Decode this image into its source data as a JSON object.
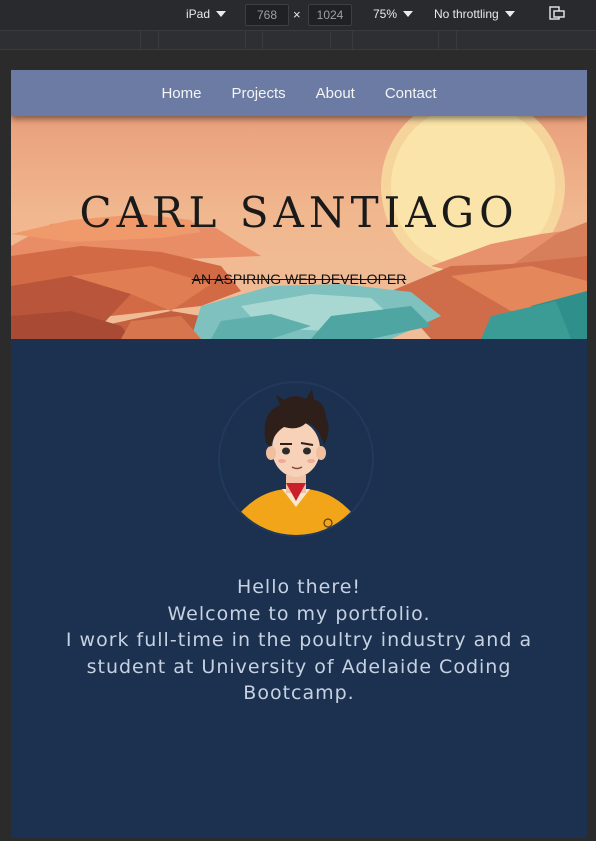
{
  "devtools": {
    "device": "iPad",
    "width": "768",
    "height": "1024",
    "times": "×",
    "zoom": "75%",
    "throttling": "No throttling",
    "rotate_icon": "rotate-icon"
  },
  "nav": {
    "items": [
      {
        "label": "Home"
      },
      {
        "label": "Projects"
      },
      {
        "label": "About"
      },
      {
        "label": "Contact"
      }
    ]
  },
  "hero": {
    "title": "CARL SANTIAGO",
    "subtitle": "AN ASPIRING WEB DEVELOPER"
  },
  "about": {
    "avatar_icon": "avatar-illustration",
    "lines": [
      "Hello there!",
      "Welcome to my portfolio.",
      "I work full-time in the poultry industry and a",
      "student at University of Adelaide Coding",
      "Bootcamp."
    ]
  },
  "colors": {
    "nav_bg": "#6b7ba3",
    "page_bg": "#1b314f",
    "text": "#c6d2e2"
  }
}
